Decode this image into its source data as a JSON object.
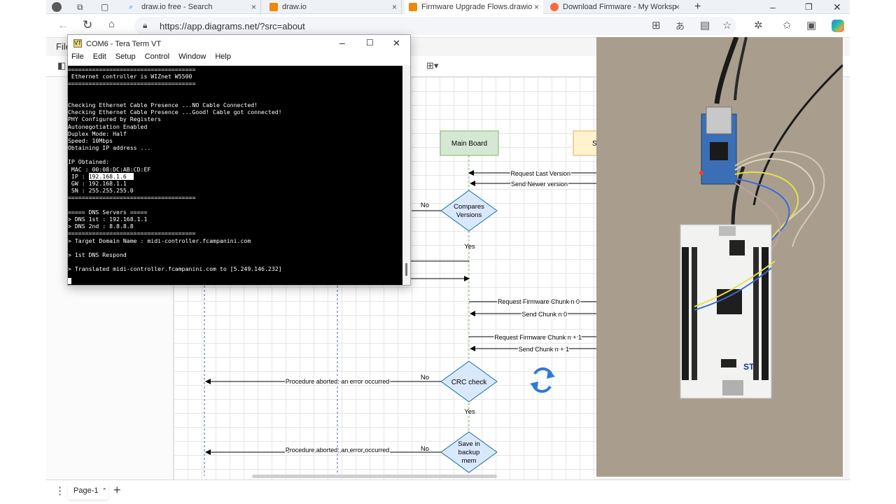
{
  "browser": {
    "tabs": [
      {
        "label": "draw.io free - Search",
        "icon_color": "#1a73e8",
        "active": false
      },
      {
        "label": "draw.io",
        "icon_color": "#f08705",
        "active": false
      },
      {
        "label": "Firmware Upgrade Flows.drawio",
        "icon_color": "#f08705",
        "active": true
      },
      {
        "label": "Download Firmware - My Worksp",
        "icon_color": "#ff6c37",
        "active": false
      }
    ],
    "new_tab": "+",
    "url": "https://app.diagrams.net/?src=about"
  },
  "drawio": {
    "file_menu": "File",
    "page_tab": "Page-1",
    "page_add": "+",
    "page_tab_arrow": "⌃",
    "dots": "⋮"
  },
  "diagram": {
    "main_board": "Main Board",
    "server_box_partial": "S",
    "messages": {
      "req_last_version": "Request Last Version",
      "send_newer": "Send Newer version",
      "req_chunk_0": "Request Firmware Chunk n 0",
      "send_chunk_0": "Send Chunk n 0",
      "req_chunk_n1": "Request Firmware Chunk n + 1",
      "send_chunk_n1": "Send Chunk n + 1",
      "abort1": "Procedure aborted: an error occurred",
      "abort2": "Procedure aborted: an error occurred"
    },
    "decisions": {
      "compare_l1": "Compares",
      "compare_l2": "Versions",
      "crc": "CRC check",
      "save_l1": "Save in",
      "save_l2": "backup",
      "save_l3": "mem"
    },
    "labels": {
      "no1": "No",
      "yes1": "Yes",
      "no2": "No",
      "yes2": "Yes",
      "no3": "No"
    }
  },
  "terminal": {
    "title": "COM6 - Tera Term VT",
    "menu": [
      "File",
      "Edit",
      "Setup",
      "Control",
      "Window",
      "Help"
    ],
    "lines": [
      "=====================================",
      " Ethernet controller is WIZnet W5500",
      "=====================================",
      "",
      "",
      "Checking Ethernet Cable Presence ...NO Cable Connected!",
      "Checking Ethernet Cable Presence ...Good! Cable got connected!",
      "PHY Configured by Registers",
      "Autonegotiation Enabled",
      "Duplex Mode: Half",
      "Speed: 10Mbps",
      "Obtaining IP address ...",
      "",
      "IP Obtained:",
      " MAC : 00:08:DC:AB:CD:EF",
      " IP : 192.168.1.6",
      " GW : 192.168.1.1",
      " SN : 255.255.255.0",
      "=====================================",
      "",
      "===== DNS Servers =====",
      "> DNS 1st : 192.168.1.1",
      "> DNS 2nd : 8.8.8.8",
      "=====================================",
      "> Target Domain Name : midi-controller.fcampanini.com",
      "",
      "> 1st DNS Respond",
      "",
      "> Translated midi-controller.fcampanini.com to [5.249.146.232]"
    ],
    "selected_line_index": 15
  },
  "colors": {
    "main_board_fill": "#d5e8d4",
    "main_board_stroke": "#82b366",
    "server_fill": "#fff2cc",
    "server_stroke": "#d6b656",
    "decision_fill": "#dae8fc",
    "decision_stroke": "#10739e",
    "sync_icon": "#2f7ad6"
  }
}
